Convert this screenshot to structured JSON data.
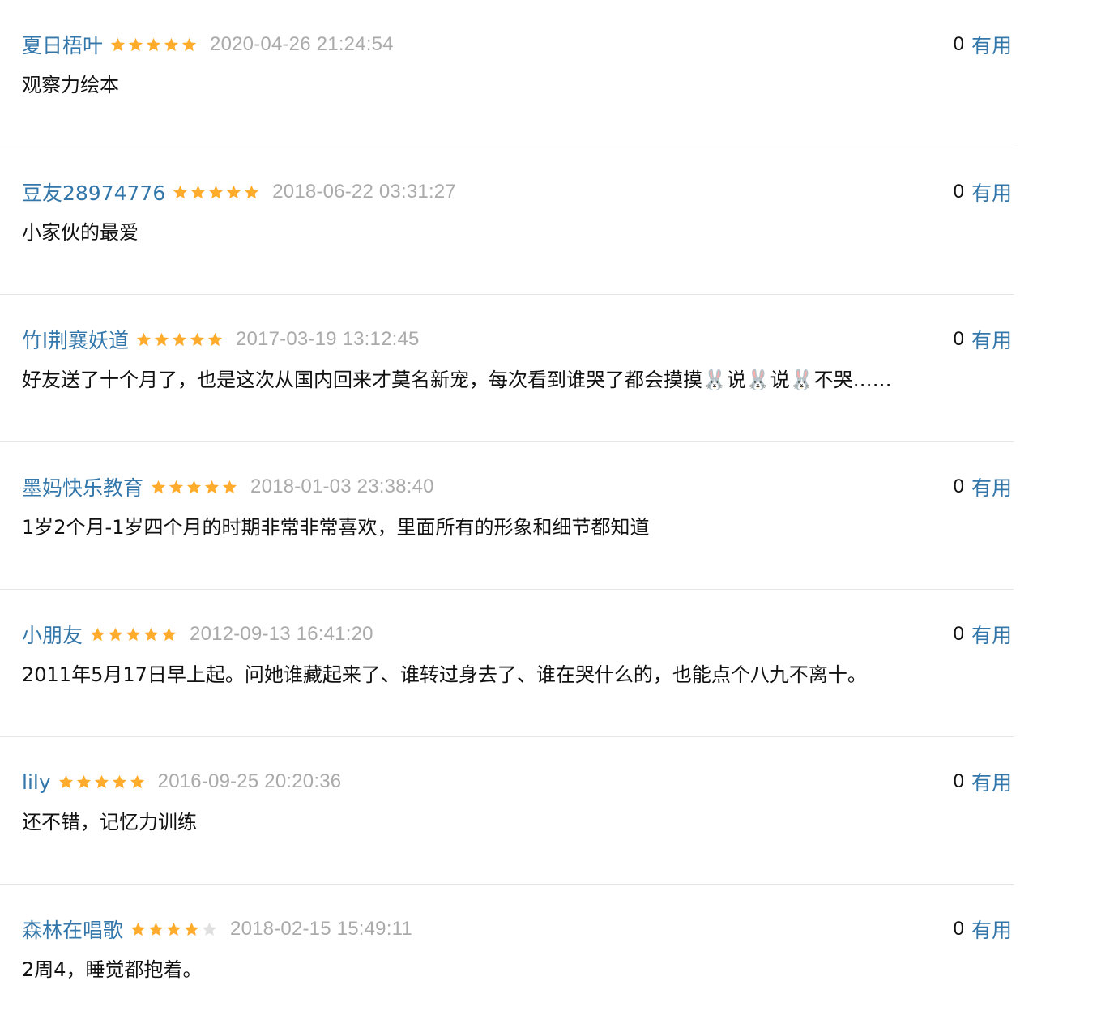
{
  "comments": [
    {
      "author": "夏日梧叶",
      "rating": 5,
      "time": "2020-04-26 21:24:54",
      "votes": "0",
      "vote_label": "有用",
      "content": "观察力绘本"
    },
    {
      "author": "豆友28974776",
      "rating": 5,
      "time": "2018-06-22 03:31:27",
      "votes": "0",
      "vote_label": "有用",
      "content": "小家伙的最爱"
    },
    {
      "author": "竹l荆襄妖道",
      "rating": 5,
      "time": "2017-03-19 13:12:45",
      "votes": "0",
      "vote_label": "有用",
      "content": "好友送了十个月了，也是这次从国内回来才莫名新宠，每次看到谁哭了都会摸摸🐰说🐰说🐰不哭……"
    },
    {
      "author": "墨妈快乐教育",
      "rating": 5,
      "time": "2018-01-03 23:38:40",
      "votes": "0",
      "vote_label": "有用",
      "content": "1岁2个月-1岁四个月的时期非常非常喜欢，里面所有的形象和细节都知道"
    },
    {
      "author": "小朋友",
      "rating": 5,
      "time": "2012-09-13 16:41:20",
      "votes": "0",
      "vote_label": "有用",
      "content": "2011年5月17日早上起。问她谁藏起来了、谁转过身去了、谁在哭什么的，也能点个八九不离十。"
    },
    {
      "author": "lily",
      "rating": 5,
      "time": "2016-09-25 20:20:36",
      "votes": "0",
      "vote_label": "有用",
      "content": "还不错，记忆力训练"
    },
    {
      "author": "森林在唱歌",
      "rating": 4,
      "time": "2018-02-15 15:49:11",
      "votes": "0",
      "vote_label": "有用",
      "content": "2周4，睡觉都抱着。"
    }
  ],
  "colors": {
    "link": "#3377aa",
    "star_filled": "#ffac2d",
    "star_empty": "#e0e0e0",
    "time": "#aaaaaa",
    "divider": "#e6e6e6"
  },
  "icons": {
    "star": "star-icon"
  }
}
